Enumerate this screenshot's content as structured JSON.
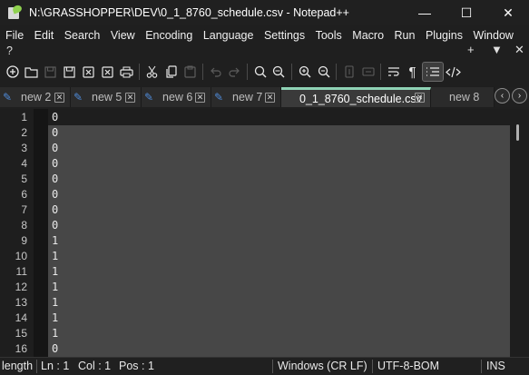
{
  "window": {
    "title": "N:\\GRASSHOPPER\\DEV\\0_1_8760_schedule.csv - Notepad++",
    "minimize": "—",
    "maximize": "☐",
    "close": "✕"
  },
  "menu": {
    "items": [
      "File",
      "Edit",
      "Search",
      "View",
      "Encoding",
      "Language",
      "Settings",
      "Tools",
      "Macro",
      "Run",
      "Plugins",
      "Window"
    ],
    "help": "?",
    "right": [
      "+",
      "▼",
      "✕"
    ]
  },
  "toolbar": {
    "icons": [
      "new-file-icon",
      "open-file-icon",
      "save-icon",
      "save-all-icon",
      "close-icon",
      "close-all-icon",
      "print-icon",
      "cut-icon",
      "copy-icon",
      "paste-icon",
      "undo-icon",
      "redo-icon",
      "find-icon",
      "replace-icon",
      "zoom-in-icon",
      "zoom-out-icon",
      "sync-vertical-icon",
      "sync-horizontal-icon",
      "word-wrap-icon",
      "show-all-chars-icon",
      "indent-guide-icon",
      "xml-tag-icon"
    ]
  },
  "tabs": [
    {
      "label": "new 2",
      "close": "✕"
    },
    {
      "label": "new 5",
      "close": "✕"
    },
    {
      "label": "new 6",
      "close": "✕"
    },
    {
      "label": "new 7",
      "close": "✕"
    },
    {
      "label": "0_1_8760_schedule.csv",
      "close": "✕",
      "active": true
    },
    {
      "label": "new 8",
      "close": ""
    }
  ],
  "tab_scroll": {
    "left": "‹",
    "right": "›"
  },
  "editor": {
    "lines": [
      {
        "n": "1",
        "text": "0"
      },
      {
        "n": "2",
        "text": "0"
      },
      {
        "n": "3",
        "text": "0"
      },
      {
        "n": "4",
        "text": "0"
      },
      {
        "n": "5",
        "text": "0"
      },
      {
        "n": "6",
        "text": "0"
      },
      {
        "n": "7",
        "text": "0"
      },
      {
        "n": "8",
        "text": "0"
      },
      {
        "n": "9",
        "text": "1"
      },
      {
        "n": "10",
        "text": "1"
      },
      {
        "n": "11",
        "text": "1"
      },
      {
        "n": "12",
        "text": "1"
      },
      {
        "n": "13",
        "text": "1"
      },
      {
        "n": "14",
        "text": "1"
      },
      {
        "n": "15",
        "text": "1"
      },
      {
        "n": "16",
        "text": "0"
      }
    ]
  },
  "status": {
    "length": "length",
    "ln": "Ln : 1",
    "col": "Col : 1",
    "pos": "Pos : 1",
    "eol": "Windows (CR LF)",
    "encoding": "UTF-8-BOM",
    "mode": "INS"
  },
  "colors": {
    "background": "#1e1e1e",
    "selection": "#474747",
    "active_tab_accent": "#8fd3b5",
    "tab_pencil": "#4f8ad8"
  }
}
